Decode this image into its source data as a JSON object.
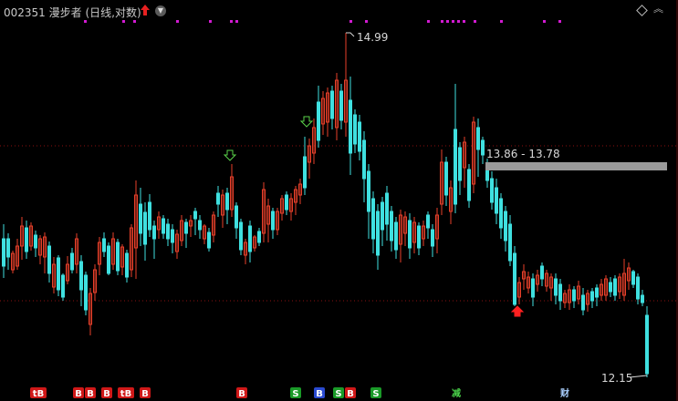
{
  "header": {
    "stock_code": "002351",
    "stock_name": "漫步者",
    "period_label": "(日线,对数)",
    "dropdown_icon": "chevron-down-icon",
    "indicator_icon": "red-up-arrow-icon"
  },
  "window_controls": {
    "diamond": "◇",
    "chevron": "︽"
  },
  "annotations": {
    "high_price": "14.99",
    "low_price": "12.15",
    "price_range": "13.86 - 13.78"
  },
  "bottom_signals": [
    {
      "text": "tB",
      "type": "buy"
    },
    {
      "text": "B",
      "type": "buy"
    },
    {
      "text": "B",
      "type": "buy"
    },
    {
      "text": "B",
      "type": "buy"
    },
    {
      "text": "tB",
      "type": "buy"
    },
    {
      "text": "B",
      "type": "buy"
    },
    {
      "text": "B",
      "type": "buy"
    },
    {
      "text": "S",
      "type": "sell"
    },
    {
      "text": "B",
      "type": "blue"
    },
    {
      "text": "S",
      "type": "sell"
    },
    {
      "text": "B",
      "type": "buy"
    },
    {
      "text": "S",
      "type": "sell"
    },
    {
      "text": "减",
      "type": "reduce"
    },
    {
      "text": "财",
      "type": "finance"
    }
  ],
  "colors": {
    "up": "#e8402a",
    "down": "#3fe0e0",
    "dots": "#d21ad2",
    "grid": "#8a1010",
    "background": "#000000"
  }
}
